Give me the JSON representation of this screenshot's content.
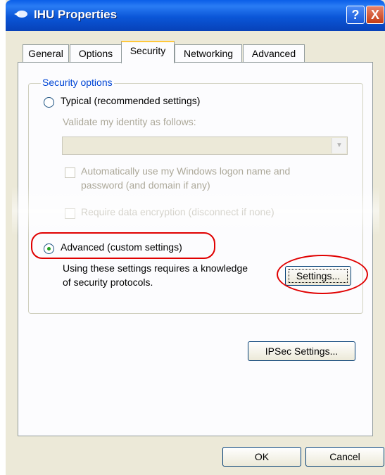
{
  "window": {
    "title": "IHU Properties",
    "help_glyph": "?",
    "close_glyph": "X"
  },
  "tabs": [
    {
      "label": "General",
      "active": false
    },
    {
      "label": "Options",
      "active": false
    },
    {
      "label": "Security",
      "active": true
    },
    {
      "label": "Networking",
      "active": false
    },
    {
      "label": "Advanced",
      "active": false
    }
  ],
  "security": {
    "group_label": "Security options",
    "typical_label": "Typical (recommended settings)",
    "typical_selected": false,
    "validate_label": "Validate my identity as follows:",
    "validate_value": "",
    "auto_logon_line1": "Automatically use my Windows logon name and",
    "auto_logon_line2": "password (and domain if any)",
    "auto_logon_checked": false,
    "require_encryption_label": "Require data encryption (disconnect if none)",
    "require_encryption_checked": false,
    "advanced_label": "Advanced (custom settings)",
    "advanced_selected": true,
    "advanced_desc_line1": "Using these settings requires a knowledge",
    "advanced_desc_line2": "of security protocols.",
    "settings_button": "Settings...",
    "ipsec_button": "IPSec Settings..."
  },
  "footer": {
    "ok_button": "OK",
    "cancel_button": "Cancel"
  },
  "colors": {
    "titlebar": "#0a56d8",
    "annotation": "#e00000",
    "groupbox_label": "#0046d5"
  }
}
